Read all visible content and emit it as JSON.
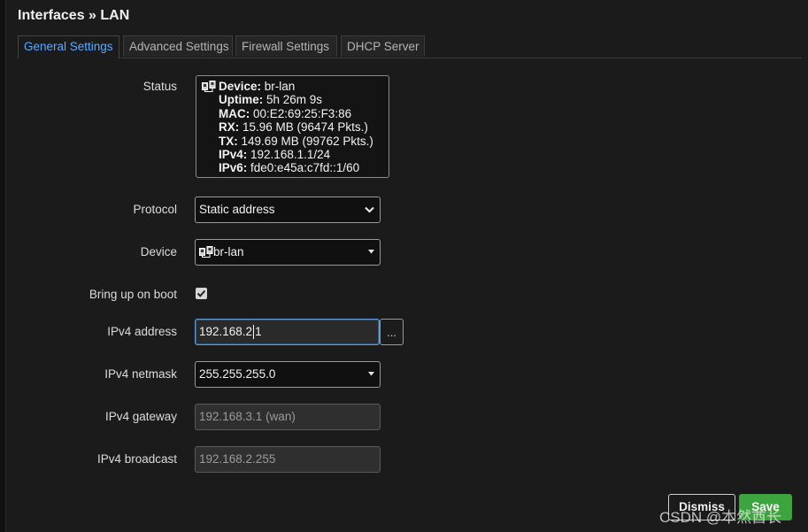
{
  "header": {
    "title": "Interfaces » LAN"
  },
  "tabs": [
    {
      "label": "General Settings",
      "active": true
    },
    {
      "label": "Advanced Settings",
      "active": false
    },
    {
      "label": "Firewall Settings",
      "active": false
    },
    {
      "label": "DHCP Server",
      "active": false
    }
  ],
  "status": {
    "label": "Status",
    "device_key": "Device:",
    "device_val": " br-lan",
    "uptime_key": "Uptime:",
    "uptime_val": " 5h 26m 9s",
    "mac_key": "MAC:",
    "mac_val": " 00:E2:69:25:F3:86",
    "rx_key": "RX:",
    "rx_val": " 15.96 MB (96474 Pkts.)",
    "tx_key": "TX:",
    "tx_val": " 149.69 MB (99762 Pkts.)",
    "ipv4_key": "IPv4:",
    "ipv4_val": " 192.168.1.1/24",
    "ipv6_key": "IPv6:",
    "ipv6_val": " fde0:e45a:c7fd::1/60"
  },
  "form": {
    "protocol": {
      "label": "Protocol",
      "value": "Static address"
    },
    "device": {
      "label": "Device",
      "value": "br-lan"
    },
    "boot": {
      "label": "Bring up on boot",
      "checked": true
    },
    "ipv4_address": {
      "label": "IPv4 address",
      "value_before_caret": "192.168.2",
      "value_after_caret": "1",
      "more_label": "..."
    },
    "ipv4_netmask": {
      "label": "IPv4 netmask",
      "value": "255.255.255.0"
    },
    "ipv4_gateway": {
      "label": "IPv4 gateway",
      "placeholder": "192.168.3.1 (wan)"
    },
    "ipv4_broadcast": {
      "label": "IPv4 broadcast",
      "placeholder": "192.168.2.255"
    }
  },
  "buttons": {
    "dismiss": "Dismiss",
    "save": "Save"
  },
  "watermark": "CSDN @本然酋长",
  "icons": {
    "device": "network-device-icon",
    "dropdown": "chevron-down-icon",
    "check": "checkmark-icon"
  },
  "colors": {
    "accent_tab": "#5da8ff",
    "save": "#3da53d",
    "focus": "#5c9bd6"
  }
}
